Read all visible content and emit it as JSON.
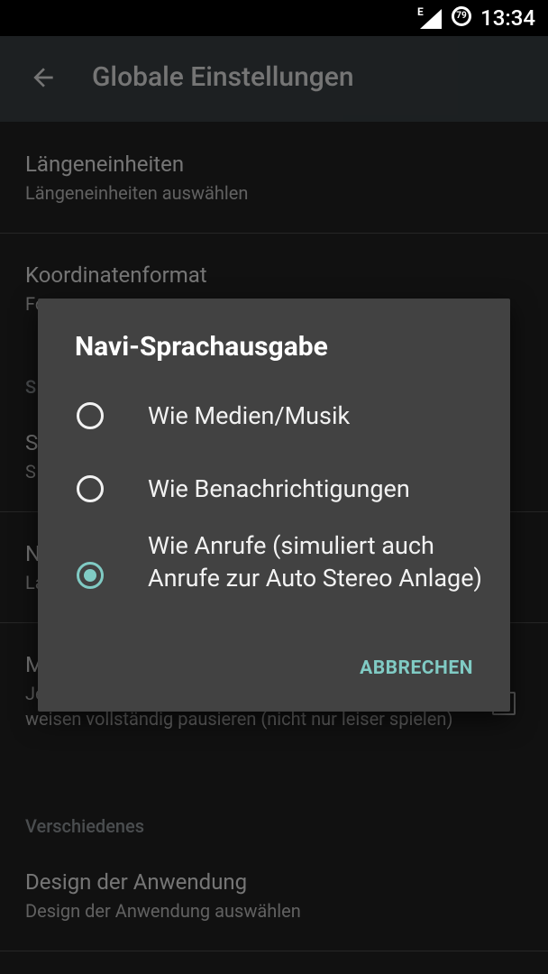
{
  "status": {
    "time": "13:34",
    "network": "E",
    "battery": "79"
  },
  "toolbar": {
    "title": "Globale Einstellungen"
  },
  "prefs": {
    "length_units": {
      "title": "Längeneinheiten",
      "summary": "Längeneinheiten auswählen"
    },
    "coord_format": {
      "title": "Koordinatenformat",
      "summary": "Fo"
    },
    "row3": {
      "title": "S",
      "summary": "S"
    },
    "row4": {
      "title": "N",
      "summary": "La"
    },
    "music": {
      "title": "M",
      "summary": "Je",
      "summary_rest": "weisen vollständig pausieren (nicht nur leiser spielen)"
    },
    "category_misc": "Verschiedenes",
    "design": {
      "title": "Design der Anwendung",
      "summary": "Design der Anwendung auswählen"
    },
    "category_s": "S"
  },
  "dialog": {
    "title": "Navi-Sprachausgabe",
    "options": [
      {
        "label": "Wie Medien/Musik",
        "selected": false
      },
      {
        "label": "Wie Benachrichtigungen",
        "selected": false
      },
      {
        "label": "Wie Anrufe (simuliert auch Anrufe zur Auto Stereo Anlage)",
        "selected": true
      }
    ],
    "cancel_label": "ABBRECHEN"
  },
  "colors": {
    "accent": "#80cbc4",
    "toolbar": "#2e363b",
    "dialog": "#424242"
  }
}
